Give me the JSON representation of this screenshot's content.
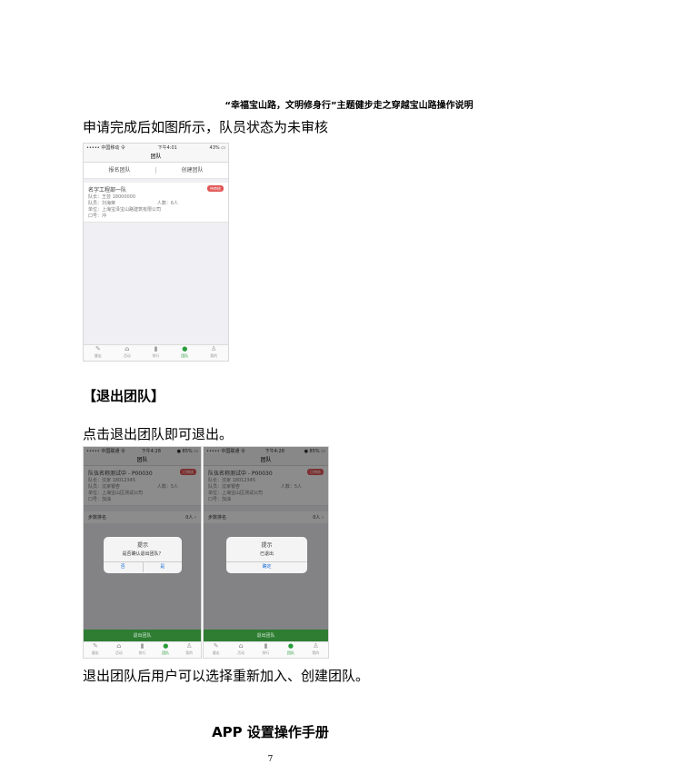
{
  "header_title": "“幸福宝山路，文明修身行”主题健步走之穿越宝山路操作说明",
  "para1": "申请完成后如图所示，队员状态为未审核",
  "section_title": "【退出团队】",
  "para2": "点击退出团队即可退出。",
  "para3": "退出团队后用户可以选择重新加入、创建团队。",
  "footer_title": "APP 设置操作手册",
  "page_number": "7",
  "phone1": {
    "status_left": "••••• 中国移动 令",
    "status_center": "下午4:01",
    "status_right": "43% ▭",
    "nav_title": "团队",
    "tab_join": "报名团队",
    "tab_create": "创建团队",
    "team_name": "名字工程部一队",
    "team_status": "待审核",
    "team_line1": "队长：王芸 18000000",
    "team_line2": "队员：刘海荣",
    "team_count": "人数：6人",
    "team_line3": "单位：上海宝泽宝山路建筑有限公司",
    "team_line4": "口号：冲",
    "tabbar": [
      "健走",
      "活动",
      "排行",
      "团队",
      "我的"
    ]
  },
  "phone2": {
    "status_left": "••••• 中国联通 令",
    "status_center": "下午4:28",
    "status_right": "● 85% ▭",
    "nav_title": "团队",
    "team_name": "队伍名称测试中 - P00030",
    "team_status": "已审核",
    "team_line1": "队长：沈家 18012345",
    "team_line2": "队员：沈家银杏",
    "team_count": "人数：5人",
    "team_line3": "单位：上海宝山区测试公司",
    "team_line4": "口号：加油",
    "row_label": "步数排名",
    "row_value": "0人 ›",
    "dialog_title": "提示",
    "dialog_msg": "是否确认退出团队？",
    "btn_cancel": "否",
    "btn_ok": "是",
    "bottom_button": "退出团队",
    "tabbar": [
      "健走",
      "活动",
      "排行",
      "团队",
      "我的"
    ]
  },
  "phone3": {
    "status_left": "••••• 中国联通 令",
    "status_center": "下午4:28",
    "status_right": "● 85% ▭",
    "nav_title": "团队",
    "team_name": "队伍名称测试中 - P00030",
    "team_status": "已审核",
    "team_line1": "队长：沈家 18012345",
    "team_line2": "队员：沈家银杏",
    "team_count": "人数：5人",
    "team_line3": "单位：上海宝山区测试公司",
    "team_line4": "口号：加油",
    "row_label": "步数排名",
    "row_value": "0人 ›",
    "dialog_title": "提示",
    "dialog_msg": "已退出",
    "btn_ok": "确定",
    "bottom_button": "退出团队",
    "tabbar": [
      "健走",
      "活动",
      "排行",
      "团队",
      "我的"
    ]
  },
  "colors": {
    "accent_green": "#2e7d32",
    "badge_red": "#e25454",
    "link_blue": "#1a6fd6"
  }
}
